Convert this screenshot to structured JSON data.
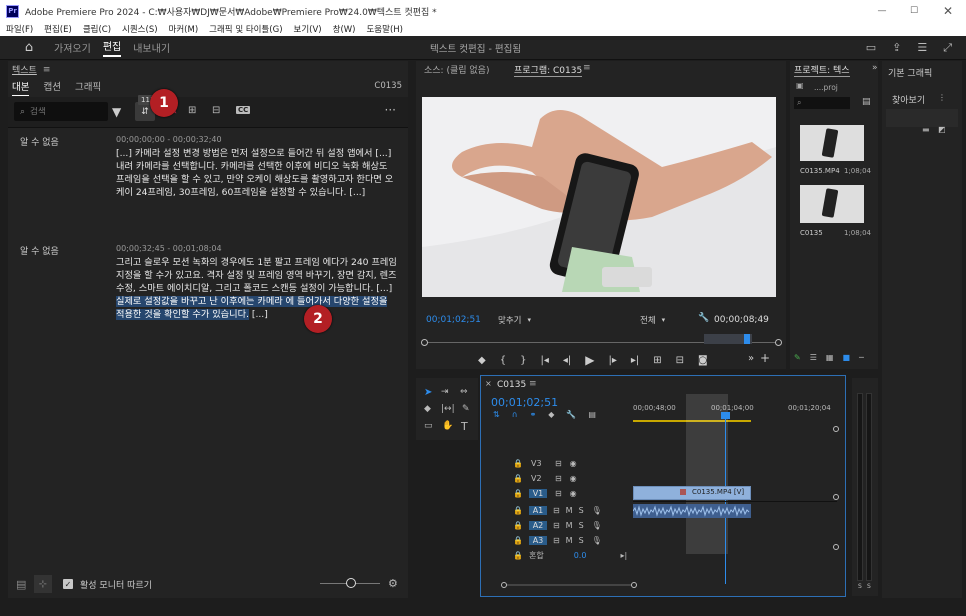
{
  "window": {
    "title": "Adobe Premiere Pro 2024 - C:₩사용자₩DJ₩문서₩Adobe₩Premiere Pro₩24.0₩텍스트 컷편집 *",
    "app_badge": "Pr"
  },
  "menu": [
    "파일(F)",
    "편집(E)",
    "클립(C)",
    "시퀀스(S)",
    "마커(M)",
    "그래픽 및 타이틀(G)",
    "보기(V)",
    "창(W)",
    "도움말(H)"
  ],
  "workspace": {
    "tabs": [
      "가져오기",
      "편집",
      "내보내기"
    ],
    "active": "편집",
    "center_title": "텍스트 컷편집 - 편집됨"
  },
  "text_panel": {
    "title": "텍스트",
    "tabs": [
      "대본",
      "캡션",
      "그래픽"
    ],
    "clip_name": "C0135",
    "search_placeholder": "검색",
    "tooltip": "11초",
    "paragraphs": [
      {
        "speaker": "알 수 없음",
        "timecode": "00;00;00;00 - 00;00;32;40",
        "text": "[...] 카메라 설정 변경 방법은 먼저 설정으로 들어간 뒤 설정 앱에서 [...] 내려 카메라를 선택합니다. 카메라를 선택한 이후에 비디오 녹화 해상도 프레임을 선택을 할 수 있고, 만약 오케이 해상도를 촬영하고자 한다면 오케이 24프레임, 30프레임, 60프레임을 설정할 수 있습니다. [...]"
      },
      {
        "speaker": "알 수 없음",
        "timecode": "00;00;32;45 - 00;01;08;04",
        "text": "그리고 슬로우 모션 녹화의 경우에도 1분 팔고 프레임 에다가 240 프레임 지정을 할 수가 있고요. 격자 설정 및 프레임 영역 바꾸기, 장면 감지, 렌즈 수정, 스마트 에이치디알, 그리고 폴코드 스캔등 설정이 가능합니다. [...] ",
        "highlight": "실제로 설정값을 바꾸고 난 이후에는 카메라 에 들어가서 다양한 설정을 적용한 것을 확인할 수가 있습니다.",
        "tail": " [...]"
      }
    ],
    "follow_monitor_label": "활성 모니터 따르기",
    "badge1": "1",
    "badge2": "2"
  },
  "monitor": {
    "source_tab": "소스: (클립 없음)",
    "program_tab": "프로그램: C0135",
    "current_time": "00;01;02;51",
    "fit": "맞추기",
    "quality": "전체",
    "duration": "00;00;08;49"
  },
  "project": {
    "tab": "프로젝트: 텍스",
    "file": "....proj",
    "items": [
      {
        "name": "C0135.MP4",
        "duration": "1;08;04"
      },
      {
        "name": "C0135",
        "duration": "1;08;04"
      }
    ]
  },
  "essential": {
    "tab": "기본 그래픽",
    "browse": "찾아보기"
  },
  "timeline": {
    "tab": "C0135",
    "timecode": "00;01;02;51",
    "ruler": [
      "00;00;48;00",
      "00;01;04;00",
      "00;01;20;04"
    ],
    "video_tracks": [
      "V3",
      "V2",
      "V1"
    ],
    "audio_tracks": [
      "A1",
      "A2",
      "A3"
    ],
    "mix_label": "혼합",
    "mix_value": "0.0",
    "clip_label": "C0135.MP4 [V]",
    "meter_labels": [
      "S",
      "S"
    ]
  }
}
